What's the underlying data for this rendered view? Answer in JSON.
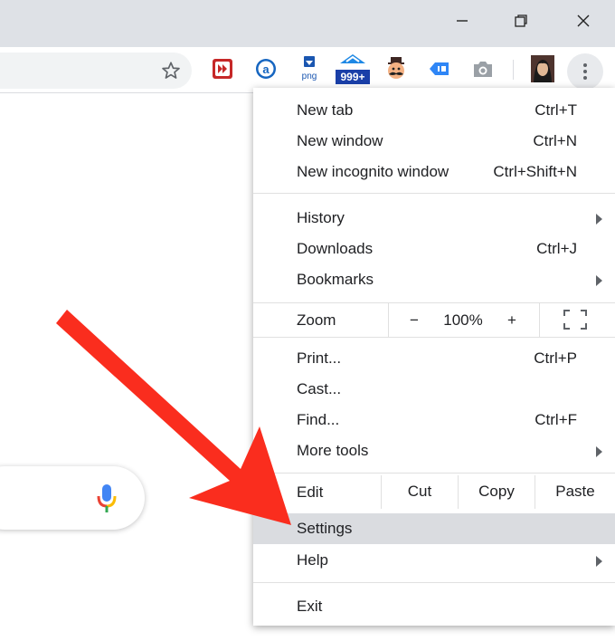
{
  "window": {
    "minimize_icon": "minimize-icon",
    "maximize_icon": "restore-icon",
    "close_icon": "close-icon"
  },
  "toolbar": {
    "bookmark_icon": "star-icon",
    "extensions": [
      "video-speed-icon",
      "amazon-assistant-icon",
      "png-download-icon",
      "notification-badge-icon",
      "mustache-face-icon",
      "page-tag-icon",
      "camera-icon"
    ],
    "badge_text": "999+",
    "png_text": "png",
    "menu_icon": "kebab-menu-icon"
  },
  "search": {
    "mic_icon": "microphone-icon"
  },
  "menu": {
    "new_tab": {
      "label": "New tab",
      "shortcut": "Ctrl+T"
    },
    "new_window": {
      "label": "New window",
      "shortcut": "Ctrl+N"
    },
    "new_incognito": {
      "label": "New incognito window",
      "shortcut": "Ctrl+Shift+N"
    },
    "history": {
      "label": "History"
    },
    "downloads": {
      "label": "Downloads",
      "shortcut": "Ctrl+J"
    },
    "bookmarks": {
      "label": "Bookmarks"
    },
    "zoom": {
      "label": "Zoom",
      "minus": "−",
      "value": "100%",
      "plus": "+"
    },
    "print": {
      "label": "Print...",
      "shortcut": "Ctrl+P"
    },
    "cast": {
      "label": "Cast..."
    },
    "find": {
      "label": "Find...",
      "shortcut": "Ctrl+F"
    },
    "more_tools": {
      "label": "More tools"
    },
    "edit": {
      "label": "Edit",
      "cut": "Cut",
      "copy": "Copy",
      "paste": "Paste"
    },
    "settings": {
      "label": "Settings"
    },
    "help": {
      "label": "Help"
    },
    "exit": {
      "label": "Exit"
    }
  },
  "colors": {
    "arrow_annotation": "#fa2d1e",
    "highlight": "#dadce0"
  }
}
